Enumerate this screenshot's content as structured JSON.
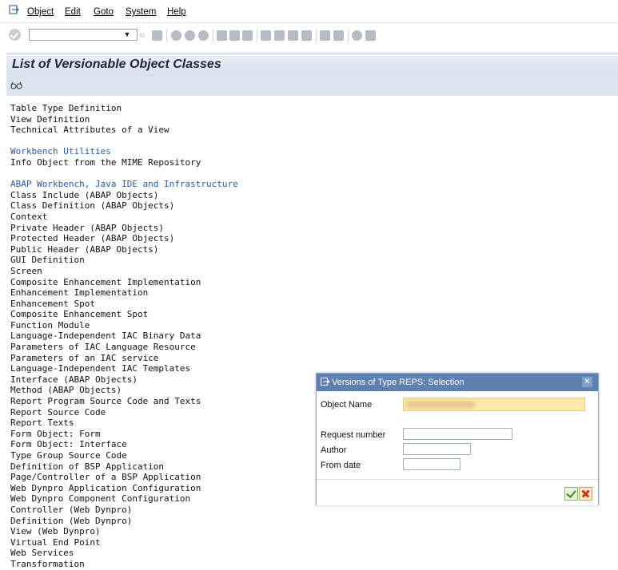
{
  "menu": {
    "items": [
      "Object",
      "Edit",
      "Goto",
      "System",
      "Help"
    ]
  },
  "toolbar": {
    "command_value": "",
    "icons": [
      "ok-icon",
      "save-icon",
      "back-icon",
      "exit-icon",
      "cancel-icon",
      "print-icon",
      "find-icon",
      "find-next-icon",
      "first-page-icon",
      "previous-page-icon",
      "next-page-icon",
      "last-page-icon",
      "new-session-icon",
      "shortcut-icon",
      "help-icon",
      "customize-layout-icon"
    ]
  },
  "page": {
    "title": "List of Versionable Object Classes"
  },
  "list": [
    {
      "text": "Table Type Definition",
      "kind": "item"
    },
    {
      "text": "View Definition",
      "kind": "item"
    },
    {
      "text": "Technical Attributes of a View",
      "kind": "item"
    },
    {
      "text": "",
      "kind": "gap"
    },
    {
      "text": "Workbench Utilities",
      "kind": "header"
    },
    {
      "text": "Info Object from the MIME Repository",
      "kind": "item"
    },
    {
      "text": "",
      "kind": "gap"
    },
    {
      "text": "ABAP Workbench, Java IDE and Infrastructure",
      "kind": "header"
    },
    {
      "text": "Class Include (ABAP Objects)",
      "kind": "item"
    },
    {
      "text": "Class Definition (ABAP Objects)",
      "kind": "item"
    },
    {
      "text": "Context",
      "kind": "item"
    },
    {
      "text": "Private Header (ABAP Objects)",
      "kind": "item"
    },
    {
      "text": "Protected Header (ABAP Objects)",
      "kind": "item"
    },
    {
      "text": "Public Header (ABAP Objects)",
      "kind": "item"
    },
    {
      "text": "GUI Definition",
      "kind": "item"
    },
    {
      "text": "Screen",
      "kind": "item"
    },
    {
      "text": "Composite Enhancement Implementation",
      "kind": "item"
    },
    {
      "text": "Enhancement Implementation",
      "kind": "item"
    },
    {
      "text": "Enhancement Spot",
      "kind": "item"
    },
    {
      "text": "Composite Enhancement Spot",
      "kind": "item"
    },
    {
      "text": "Function Module",
      "kind": "item"
    },
    {
      "text": "Language-Independent IAC Binary Data",
      "kind": "item"
    },
    {
      "text": "Parameters of IAC Language Resource",
      "kind": "item"
    },
    {
      "text": "Parameters of an IAC service",
      "kind": "item"
    },
    {
      "text": "Language-Independent IAC Templates",
      "kind": "item"
    },
    {
      "text": "Interface (ABAP Objects)",
      "kind": "item"
    },
    {
      "text": "Method (ABAP Objects)",
      "kind": "item"
    },
    {
      "text": "Report Program Source Code and Texts",
      "kind": "item"
    },
    {
      "text": "Report Source Code",
      "kind": "item"
    },
    {
      "text": "Report Texts",
      "kind": "item"
    },
    {
      "text": "Form Object: Form",
      "kind": "item"
    },
    {
      "text": "Form Object: Interface",
      "kind": "item"
    },
    {
      "text": "Type Group Source Code",
      "kind": "item"
    },
    {
      "text": "Definition of BSP Application",
      "kind": "item"
    },
    {
      "text": "Page/Controller of a BSP Application",
      "kind": "item"
    },
    {
      "text": "Web Dynpro Application Configuration",
      "kind": "item"
    },
    {
      "text": "Web Dynpro Component Configuration",
      "kind": "item"
    },
    {
      "text": "Controller (Web Dynpro)",
      "kind": "item"
    },
    {
      "text": "Definition (Web Dynpro)",
      "kind": "item"
    },
    {
      "text": "View (Web Dynpro)",
      "kind": "item"
    },
    {
      "text": "Virtual End Point",
      "kind": "item"
    },
    {
      "text": "Web Services",
      "kind": "item"
    },
    {
      "text": "Transformation",
      "kind": "item"
    }
  ],
  "dialog": {
    "title": "Versions of Type REPS: Selection",
    "close_icon": "close-icon",
    "object_name_label": "Object Name",
    "object_name_value": "",
    "request_number_label": "Request number",
    "request_number_value": "",
    "author_label": "Author",
    "author_value": "",
    "from_date_label": "From date",
    "from_date_value": "",
    "confirm_icon": "checkmark-icon",
    "cancel_icon": "cancel-x-icon"
  },
  "colors": {
    "dialog_title_bar": "#5d80b1",
    "required_field": "#fde9a7",
    "section_header": "#2b5aa8"
  }
}
